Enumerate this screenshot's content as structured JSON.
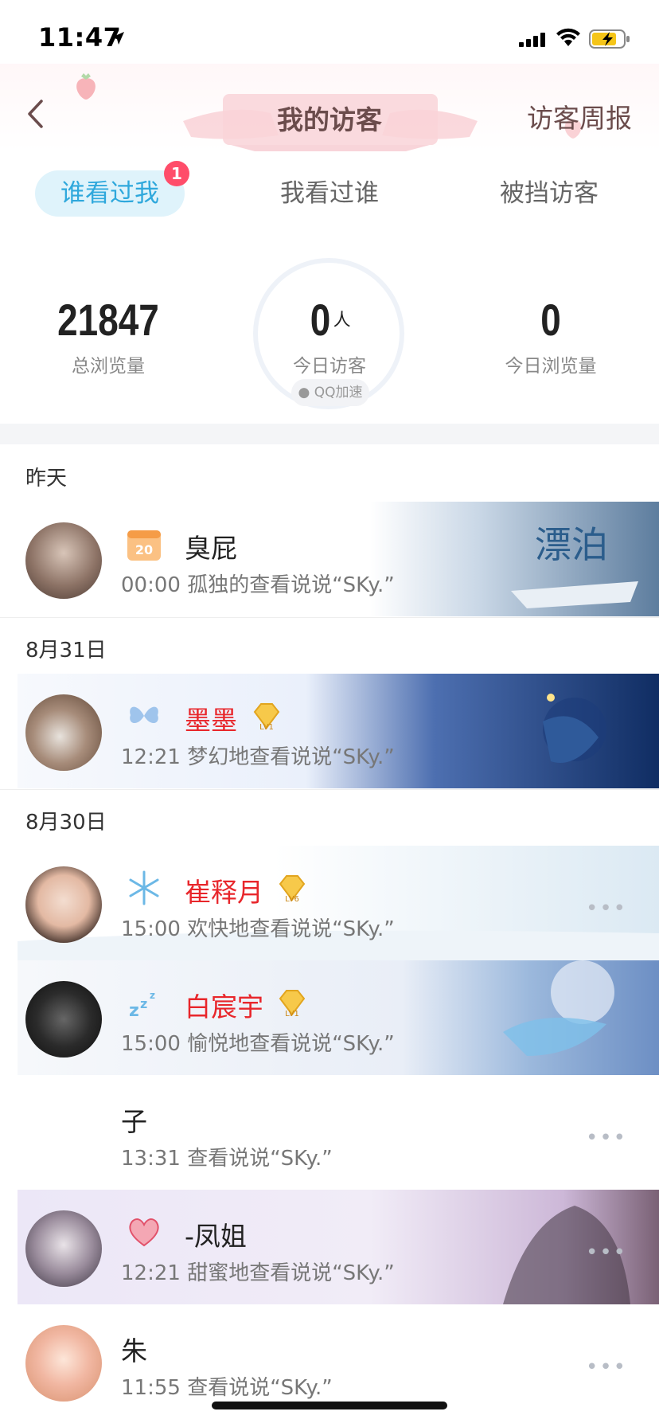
{
  "status_bar": {
    "time": "11:47"
  },
  "nav": {
    "title": "我的访客",
    "right_action": "访客周报"
  },
  "tabs": [
    {
      "label": "谁看过我",
      "active": true,
      "badge": "1"
    },
    {
      "label": "我看过谁",
      "active": false
    },
    {
      "label": "被挡访客",
      "active": false
    }
  ],
  "stats": {
    "total_views": {
      "value": "21847",
      "label": "总浏览量"
    },
    "today_visitors": {
      "value": "0",
      "unit": "人",
      "label": "今日访客",
      "tag": "QQ加速"
    },
    "today_views": {
      "value": "0",
      "label": "今日浏览量"
    }
  },
  "sections": [
    {
      "date": "昨天",
      "visitors": [
        {
          "name": "臭屁",
          "vip": false,
          "icon": "calendar-20-icon",
          "icon_text": "20",
          "time": "00:00",
          "action": "孤独的查看说说“SKy.”",
          "banner": "ocean-boat",
          "banner_text": "漂泊"
        }
      ]
    },
    {
      "date": "8月31日",
      "visitors": [
        {
          "name": "墨墨",
          "vip": true,
          "level": "LV1",
          "icon": "butterfly-icon",
          "time": "12:21",
          "action": "梦幻地查看说说“SKy.”",
          "banner": "anime-night"
        }
      ]
    },
    {
      "date": "8月30日",
      "visitors": [
        {
          "name": "崔释月",
          "vip": true,
          "level": "LV6",
          "icon": "snowflake-icon",
          "time": "15:00",
          "action": "欢快地查看说说“SKy.”",
          "banner": "snow",
          "more": "•••"
        },
        {
          "name": "白宸宇",
          "vip": true,
          "level": "LV1",
          "icon": "zzz-icon",
          "time": "15:00",
          "action": "愉悦地查看说说“SKy.”",
          "banner": "anime-moon"
        },
        {
          "name": "子",
          "vip": false,
          "time": "13:31",
          "action": "查看说说“SKy.”",
          "more": "•••"
        },
        {
          "name": "-凤姐",
          "vip": false,
          "icon": "heart-icon",
          "time": "12:21",
          "action": "甜蜜地查看说说“SKy.”",
          "banner": "anime-couple",
          "more": "•••"
        },
        {
          "name": "朱",
          "vip": false,
          "time": "11:55",
          "action": "查看说说“SKy.”",
          "more": "•••"
        }
      ]
    }
  ],
  "colors": {
    "accent": "#2fa8dc",
    "vip_name": "#e8262b",
    "badge": "#ff4d6a",
    "title": "#6b4c4c"
  }
}
